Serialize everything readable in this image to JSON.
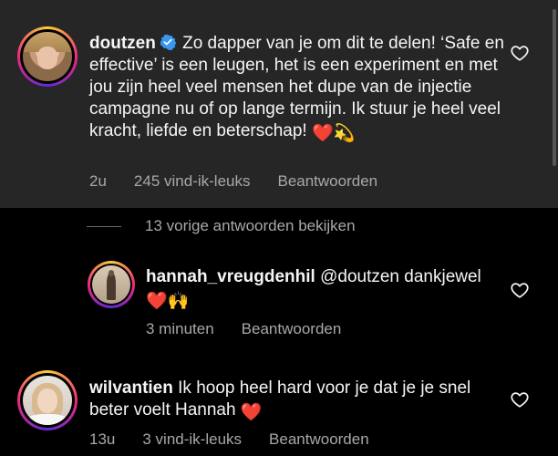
{
  "comments": [
    {
      "username": "doutzen",
      "verified": true,
      "text": "Zo dapper van je om dit te delen! ‘Safe en effective’ is een leugen, het is een experiment en met jou zijn heel veel mensen het dupe van de injectie campagne nu of op lange termijn. Ik stuur je heel veel kracht, liefde en beterschap!",
      "emojis": [
        "❤️",
        "💫"
      ],
      "time": "2u",
      "likes": "245 vind-ik-leuks",
      "reply_label": "Beantwoorden"
    },
    {
      "username": "hannah_vreugdenhil",
      "mention": "@doutzen",
      "text": "dankjewel",
      "emojis": [
        "❤️",
        "🙌"
      ],
      "time": "3 minuten",
      "reply_label": "Beantwoorden"
    },
    {
      "username": "wilvantien",
      "text": "Ik hoop heel hard voor je dat je je snel beter voelt Hannah",
      "emojis": [
        "❤️"
      ],
      "time": "13u",
      "likes": "3 vind-ik-leuks",
      "reply_label": "Beantwoorden"
    }
  ],
  "view_previous_replies": "13 vorige antwoorden bekijken",
  "icons": {
    "verified": "verified-badge-icon",
    "like": "heart-outline-icon"
  },
  "colors": {
    "highlight_bg": "#262626",
    "verified": "#3897f0",
    "heart": "#ff3040",
    "secondary_text": "#a8a8a8"
  }
}
